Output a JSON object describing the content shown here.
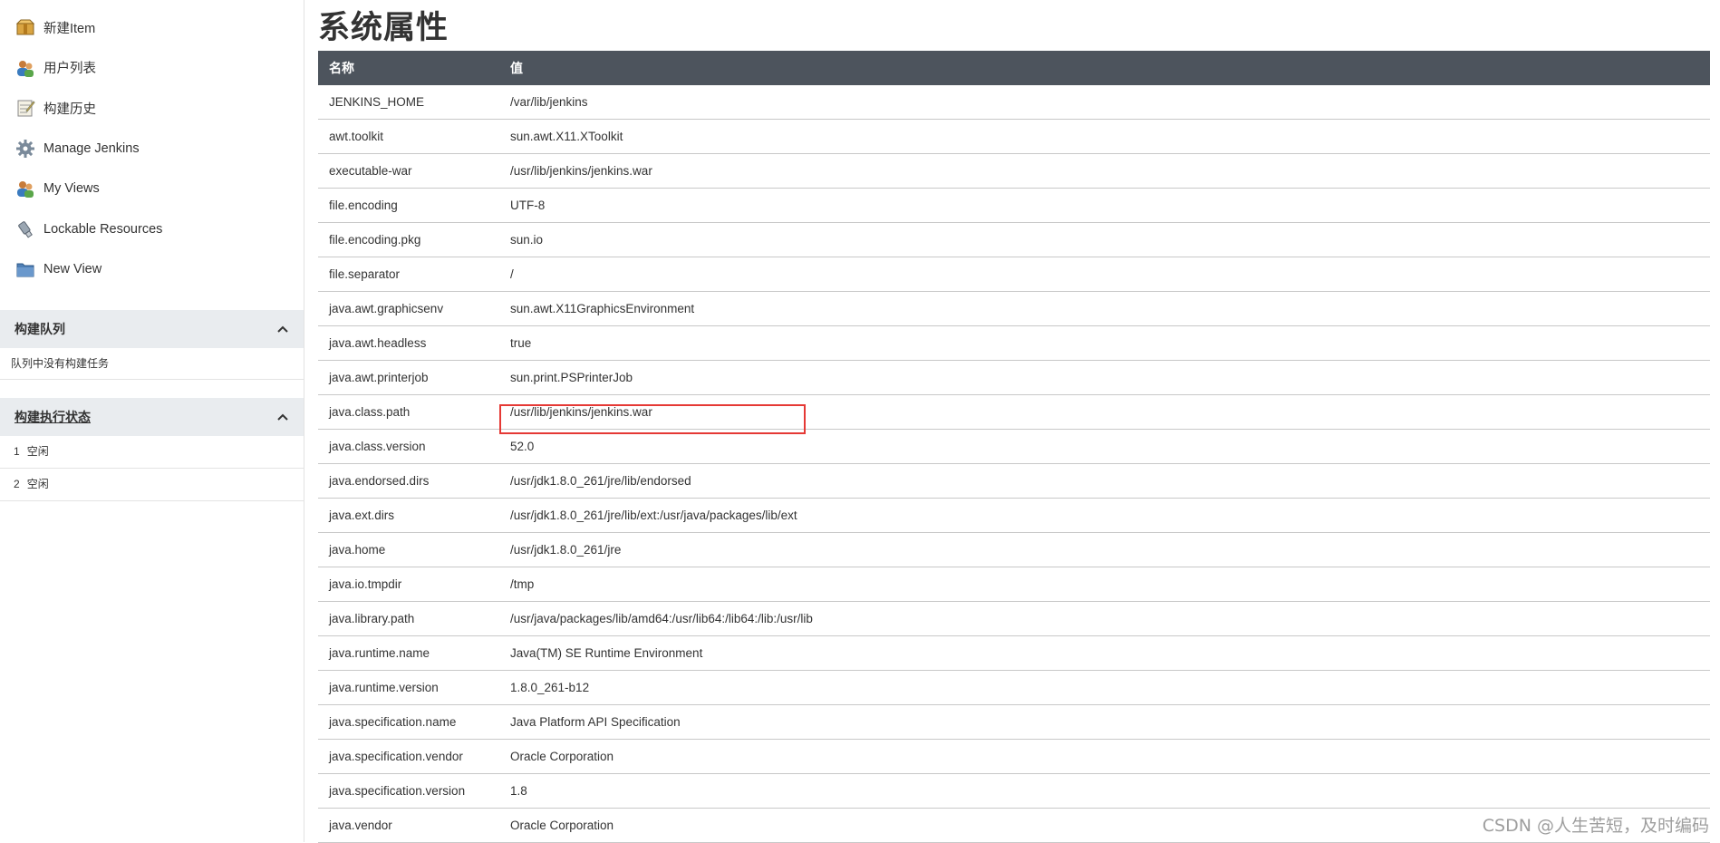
{
  "sidebar": {
    "nav": [
      {
        "label": "新建Item",
        "icon": "package-icon"
      },
      {
        "label": "用户列表",
        "icon": "users-icon"
      },
      {
        "label": "构建历史",
        "icon": "notepad-icon"
      },
      {
        "label": "Manage Jenkins",
        "icon": "gear-icon"
      },
      {
        "label": "My Views",
        "icon": "users-icon"
      },
      {
        "label": "Lockable Resources",
        "icon": "usb-icon"
      },
      {
        "label": "New View",
        "icon": "folder-icon"
      }
    ],
    "queue": {
      "title": "构建队列",
      "empty_text": "队列中没有构建任务"
    },
    "executors": {
      "title": "构建执行状态",
      "rows": [
        {
          "num": "1",
          "status": "空闲"
        },
        {
          "num": "2",
          "status": "空闲"
        }
      ]
    }
  },
  "main": {
    "title": "系统属性",
    "table": {
      "headers": {
        "name": "名称",
        "value": "值"
      },
      "rows": [
        {
          "name": "JENKINS_HOME",
          "value": "/var/lib/jenkins"
        },
        {
          "name": "awt.toolkit",
          "value": "sun.awt.X11.XToolkit"
        },
        {
          "name": "executable-war",
          "value": "/usr/lib/jenkins/jenkins.war"
        },
        {
          "name": "file.encoding",
          "value": "UTF-8"
        },
        {
          "name": "file.encoding.pkg",
          "value": "sun.io"
        },
        {
          "name": "file.separator",
          "value": "/"
        },
        {
          "name": "java.awt.graphicsenv",
          "value": "sun.awt.X11GraphicsEnvironment"
        },
        {
          "name": "java.awt.headless",
          "value": "true"
        },
        {
          "name": "java.awt.printerjob",
          "value": "sun.print.PSPrinterJob"
        },
        {
          "name": "java.class.path",
          "value": "/usr/lib/jenkins/jenkins.war"
        },
        {
          "name": "java.class.version",
          "value": "52.0"
        },
        {
          "name": "java.endorsed.dirs",
          "value": "/usr/jdk1.8.0_261/jre/lib/endorsed"
        },
        {
          "name": "java.ext.dirs",
          "value": "/usr/jdk1.8.0_261/jre/lib/ext:/usr/java/packages/lib/ext"
        },
        {
          "name": "java.home",
          "value": "/usr/jdk1.8.0_261/jre"
        },
        {
          "name": "java.io.tmpdir",
          "value": "/tmp"
        },
        {
          "name": "java.library.path",
          "value": "/usr/java/packages/lib/amd64:/usr/lib64:/lib64:/lib:/usr/lib"
        },
        {
          "name": "java.runtime.name",
          "value": "Java(TM) SE Runtime Environment"
        },
        {
          "name": "java.runtime.version",
          "value": "1.8.0_261-b12"
        },
        {
          "name": "java.specification.name",
          "value": "Java Platform API Specification"
        },
        {
          "name": "java.specification.vendor",
          "value": "Oracle Corporation"
        },
        {
          "name": "java.specification.version",
          "value": "1.8"
        },
        {
          "name": "java.vendor",
          "value": "Oracle Corporation"
        }
      ]
    }
  },
  "watermark": "CSDN @人生苦短，及时编码",
  "colors": {
    "header_bg": "#4d545d",
    "highlight_border": "#e53935",
    "panel_bg": "#e9ecef"
  }
}
